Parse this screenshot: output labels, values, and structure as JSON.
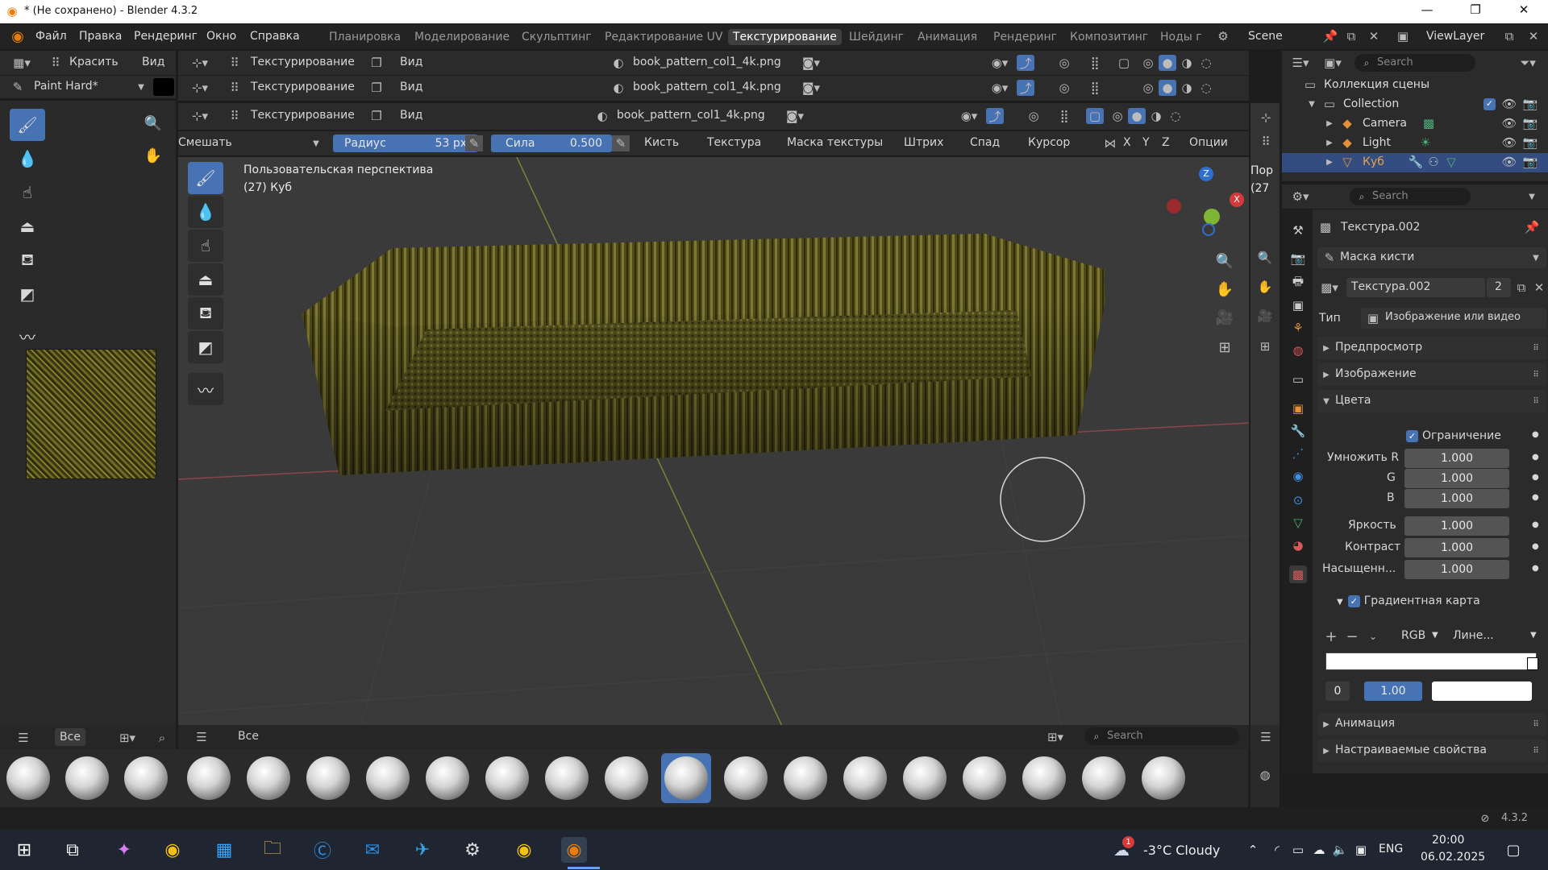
{
  "window": {
    "title": "* (Не сохранено) - Blender 4.3.2"
  },
  "menu": {
    "items": [
      "Файл",
      "Правка",
      "Рендеринг",
      "Окно",
      "Справка"
    ]
  },
  "workspaces": [
    "Планировка",
    "Моделирование",
    "Скульптинг",
    "Редактирование UV",
    "Текстурирование",
    "Шейдинг",
    "Анимация",
    "Рендеринг",
    "Композитинг",
    "Ноды г"
  ],
  "active_workspace": "Текстурирование",
  "scene_name": "Scene",
  "view_layer": "ViewLayer",
  "image_editor_header": {
    "mode": "Красить",
    "view": "Вид",
    "brush_name": "Paint Hard*"
  },
  "viewport_headers": [
    {
      "mode": "Текстурирование",
      "view": "Вид",
      "image": "book_pattern_col1_4k.png"
    },
    {
      "mode": "Текстурирование",
      "view": "Вид",
      "image": "book_pattern_col1_4k.png"
    },
    {
      "mode": "Текстурирование",
      "view": "Вид",
      "image": "book_pattern_col1_4k.png"
    }
  ],
  "tool_settings": {
    "blend": "Смешать",
    "radius_label": "Радиус",
    "radius_value": "53 px",
    "strength_label": "Сила",
    "strength_value": "0.500",
    "menus": [
      "Кисть",
      "Текстура",
      "Маска текстуры",
      "Штрих",
      "Спад",
      "Курсор"
    ],
    "axes": [
      "X",
      "Y",
      "Z"
    ],
    "options": "Опции"
  },
  "viewport": {
    "perspective": "Пользовательская перспектива",
    "object": "(27) Куб",
    "clip_label": "Пор",
    "clip_num": "(27"
  },
  "outliner": {
    "search_placeholder": "Search",
    "root": "Коллекция сцены",
    "items": [
      {
        "name": "Collection"
      },
      {
        "name": "Camera"
      },
      {
        "name": "Light"
      },
      {
        "name": "Куб"
      }
    ]
  },
  "properties": {
    "search_placeholder": "Search",
    "texture_title": "Текстура.002",
    "brush_mask": "Маска кисти",
    "texture_name": "Текстура.002",
    "texture_users": "2",
    "type_label": "Тип",
    "type_value": "Изображение или видео",
    "sections": {
      "preview": "Предпросмотр",
      "image": "Изображение",
      "colors": "Цвета",
      "animation": "Анимация",
      "custom": "Настраиваемые свойства"
    },
    "clamp_label": "Ограничение",
    "multiply_r_label": "Умножить R",
    "multiply_r": "1.000",
    "g_label": "G",
    "g_value": "1.000",
    "b_label": "B",
    "b_value": "1.000",
    "brightness_label": "Яркость",
    "brightness": "1.000",
    "contrast_label": "Контраст",
    "contrast": "1.000",
    "saturation_label": "Насыщенн...",
    "saturation": "1.000",
    "ramp_label": "Градиентная карта",
    "ramp_mode": "RGB",
    "ramp_interp": "Лине...",
    "ramp_index": "0",
    "ramp_pos": "1.00"
  },
  "asset_filters": {
    "left_all": "Все",
    "mid_all": "Все",
    "search_placeholder": "Search"
  },
  "brushes_count": 20,
  "selected_brush_index": 11,
  "status": {
    "version": "4.3.2"
  },
  "taskbar": {
    "weather": "-3°C Cloudy",
    "lang": "ENG",
    "time": "20:00",
    "date": "06.02.2025",
    "notify_badge": "1"
  },
  "colors": {
    "accent": "#4772b3",
    "sofa": "#5a5520"
  }
}
